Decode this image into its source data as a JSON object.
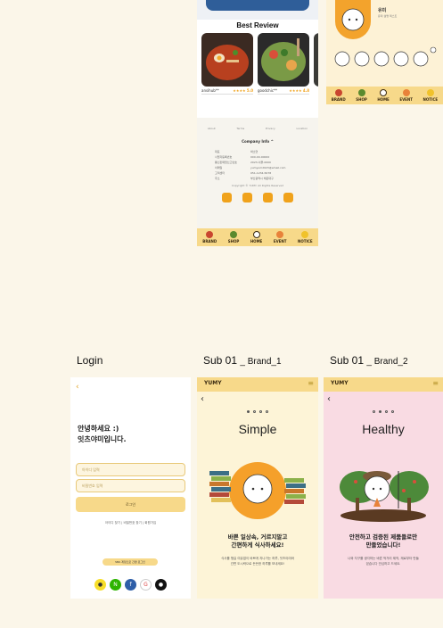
{
  "labels": {
    "login": "Login",
    "sub1_main": "Sub 01",
    "sub1_suffix": "_ Brand_1",
    "sub2_main": "Sub 01",
    "sub2_suffix": "_ Brand_2"
  },
  "review": {
    "title": "Best Review",
    "cards": [
      {
        "name": "ansihub**",
        "stars": "★★★★",
        "score": "5.0"
      },
      {
        "name": "goodchic**",
        "stars": "★★★★",
        "score": "4.8"
      }
    ]
  },
  "footer": {
    "links": [
      "About",
      "Terms",
      "Privacy",
      "Location"
    ],
    "company_label": "Company Info",
    "rows": [
      [
        "대표",
        "박소연"
      ],
      [
        "사업자등록번호",
        "000-00-00000"
      ],
      [
        "통신판매업신고번호",
        "2023-서울-0000"
      ],
      [
        "이메일",
        "yumyum2023@email.com"
      ],
      [
        "고객센터",
        "051-1234-5678"
      ],
      [
        "주소",
        "부산광역시 해운대구"
      ]
    ],
    "copyright": "Copyright © YUMY. All Rights Reserved"
  },
  "nav": [
    "BRAND",
    "SHOP",
    "HOME",
    "EVENT",
    "NOTICE"
  ],
  "mascot": {
    "title": "유미",
    "text": "유미 설명 텍스트"
  },
  "brand": "YUMY",
  "login": {
    "greeting_line1": "안녕하세요 :)",
    "greeting_line2": "잇츠야미입니다.",
    "id_placeholder": "아이디 입력",
    "pw_placeholder": "비밀번호 입력",
    "login_button": "로그인",
    "find_id": "아이디 찾기",
    "find_pw": "비밀번호 찾기",
    "signup": "회원가입",
    "easy_login": "SNS 계정으로 간편 로그인"
  },
  "brand1": {
    "heading": "Simple",
    "line1": "바쁜 일상속, 거르지말고",
    "line2": "간편하게 식사하세요!",
    "desc": "식사를 챙길 여유없이 바쁘게 지나가는 하루, 잇츠야미와 간편 도시락으로 든든한 하루를 보내세요!"
  },
  "brand2": {
    "heading": "Healthy",
    "line1": "안전하고 검증된 제품들로만",
    "line2": "만들었습니다!",
    "desc": "나와 지구를 생각하는 바른 먹거리 제작, 재료부터 만들었습니다 안심하고 드세요."
  }
}
